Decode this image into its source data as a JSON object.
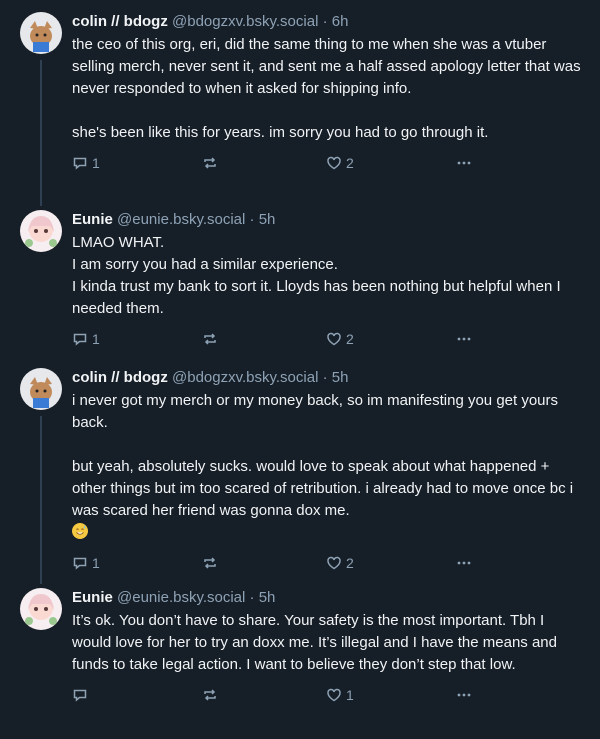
{
  "posts": [
    {
      "author": "colin // bdogz",
      "handle": "@bdogzxv.bsky.social",
      "time": "6h",
      "lines": [
        "the ceo of this org, eri, did the same thing to me when she was a vtuber selling merch, never sent it, and sent me a half assed apology letter that was never responded to when it asked for shipping info.",
        "",
        "she's been like this for years. im sorry you had to go through it."
      ],
      "replies": "1",
      "reposts": "",
      "likes": "2"
    },
    {
      "author": "Eunie",
      "handle": "@eunie.bsky.social",
      "time": "5h",
      "lines": [
        "LMAO WHAT.",
        "I am sorry you had a similar experience.",
        "I kinda trust my bank to sort it. Lloyds has been nothing but helpful when I needed them."
      ],
      "replies": "1",
      "reposts": "",
      "likes": "2"
    },
    {
      "author": "colin // bdogz",
      "handle": "@bdogzxv.bsky.social",
      "time": "5h",
      "lines": [
        "i never got my merch or my money back, so im manifesting you get yours back.",
        "",
        "but yeah, absolutely sucks. would love to speak about what happened + other things but im too scared of retribution. i already had to move once bc i was scared her friend was gonna dox me."
      ],
      "emoji": "sweat-smile-emoji",
      "replies": "1",
      "reposts": "",
      "likes": "2"
    },
    {
      "author": "Eunie",
      "handle": "@eunie.bsky.social",
      "time": "5h",
      "lines": [
        "It’s ok. You don’t have to share. Your safety is the most important. Tbh I would love for her to try an doxx me. It’s illegal and I have the means and funds to take legal action. I want to believe they don’t step that low."
      ],
      "replies": "",
      "reposts": "",
      "likes": "1"
    }
  ],
  "separator": " · ",
  "colors": {
    "background": "#161e27",
    "text": "#f1f3f5",
    "muted": "#8ea2b5",
    "thread_line": "#2e4052"
  }
}
